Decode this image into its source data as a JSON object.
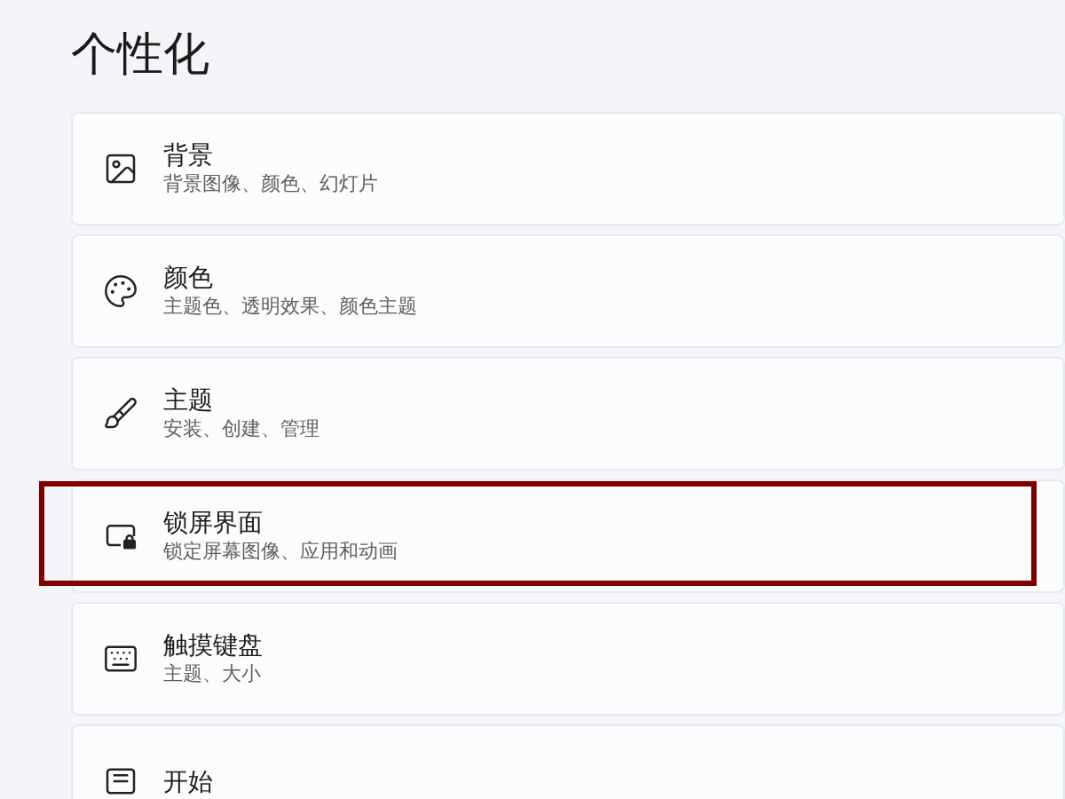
{
  "page_title": "个性化",
  "items": [
    {
      "kind": "image",
      "title": "背景",
      "subtitle": "背景图像、颜色、幻灯片",
      "highlighted": false
    },
    {
      "kind": "palette",
      "title": "颜色",
      "subtitle": "主题色、透明效果、颜色主题",
      "highlighted": false
    },
    {
      "kind": "brush",
      "title": "主题",
      "subtitle": "安装、创建、管理",
      "highlighted": false
    },
    {
      "kind": "lockscreen",
      "title": "锁屏界面",
      "subtitle": "锁定屏幕图像、应用和动画",
      "highlighted": true
    },
    {
      "kind": "keyboard",
      "title": "触摸键盘",
      "subtitle": "主题、大小",
      "highlighted": false
    },
    {
      "kind": "start",
      "title": "开始",
      "highlighted": false
    }
  ]
}
